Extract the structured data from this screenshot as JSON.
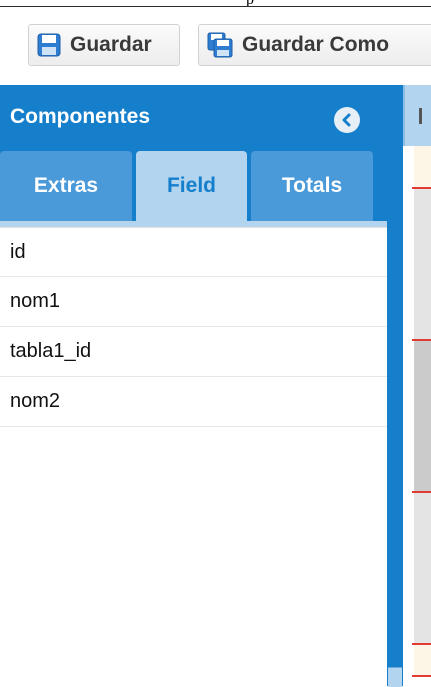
{
  "toolbar": {
    "save_label": "Guardar",
    "save_as_label": "Guardar Como"
  },
  "panel": {
    "title": "Componentes",
    "tabs": [
      {
        "label": "Extras",
        "active": false
      },
      {
        "label": "Field",
        "active": true
      },
      {
        "label": "Totals",
        "active": false
      }
    ],
    "fields": [
      "id",
      "nom1",
      "tabla1_id",
      "nom2"
    ]
  },
  "colors": {
    "accent": "#157fcc",
    "tab_active": "#b3d4ee",
    "tab_inactive": "#4a99d8",
    "band_line": "#e03c31",
    "header_band": "#fdf5e6"
  },
  "icons": {
    "save": "floppy-disk-icon",
    "save_as": "floppy-disks-icon",
    "collapse": "chevron-left-circle-icon"
  }
}
